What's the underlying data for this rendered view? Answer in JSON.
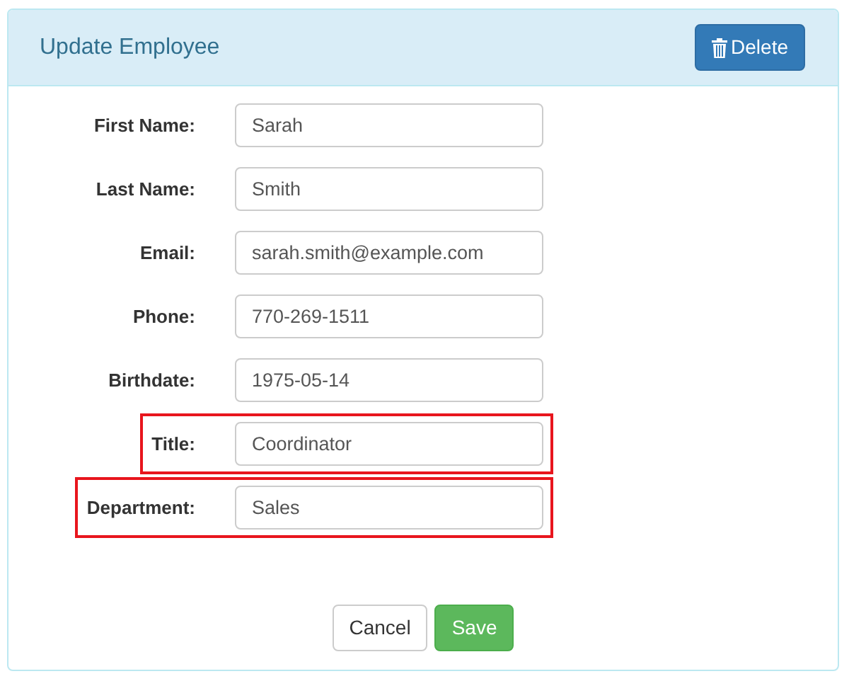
{
  "panel": {
    "title": "Update Employee",
    "delete_button": "Delete"
  },
  "fields": [
    {
      "label": "First Name:",
      "value": "Sarah",
      "highlighted": false
    },
    {
      "label": "Last Name:",
      "value": "Smith",
      "highlighted": false
    },
    {
      "label": "Email:",
      "value": "sarah.smith@example.com",
      "highlighted": false
    },
    {
      "label": "Phone:",
      "value": "770-269-1511",
      "highlighted": false
    },
    {
      "label": "Birthdate:",
      "value": "1975-05-14",
      "highlighted": false
    },
    {
      "label": "Title:",
      "value": "Coordinator",
      "highlighted": true
    },
    {
      "label": "Department:",
      "value": "Sales",
      "highlighted": true
    }
  ],
  "buttons": {
    "cancel": "Cancel",
    "save": "Save"
  }
}
